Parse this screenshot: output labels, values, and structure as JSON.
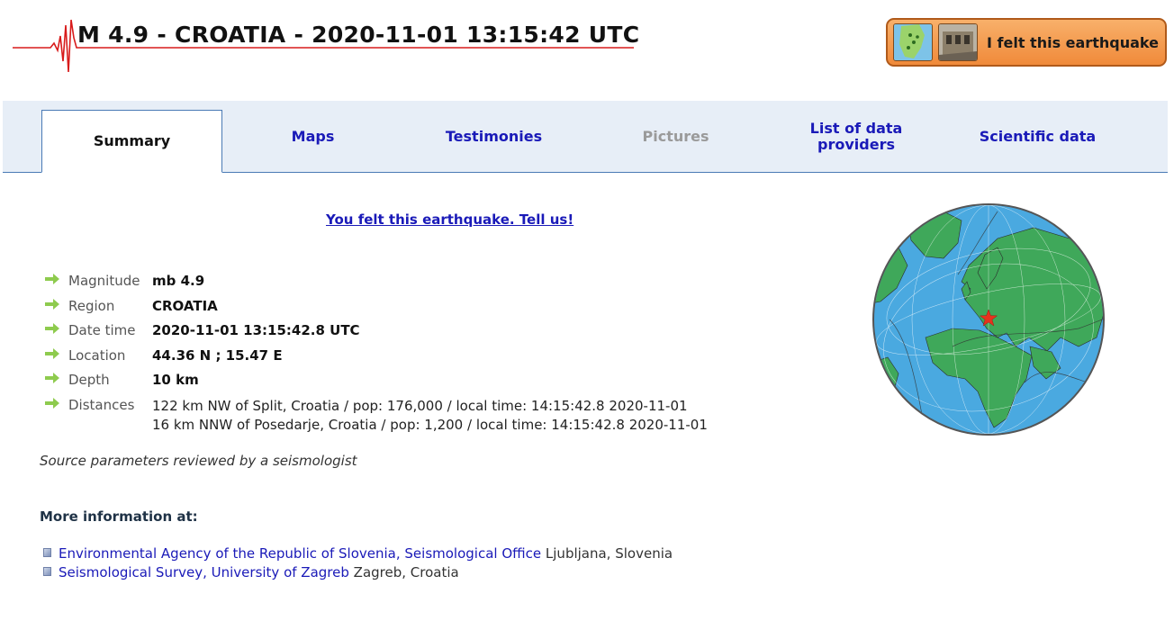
{
  "header": {
    "title": "M 4.9 - CROATIA - 2020-11-01 13:15:42 UTC",
    "felt_button_label": "I felt this earthquake"
  },
  "tabs": [
    {
      "label": "Summary",
      "active": true
    },
    {
      "label": "Maps"
    },
    {
      "label": "Testimonies"
    },
    {
      "label": "Pictures",
      "disabled": true
    },
    {
      "label": "List of data providers"
    },
    {
      "label": "Scientific data"
    }
  ],
  "summary": {
    "tell_us": "You felt this earthquake. Tell us!",
    "params": [
      {
        "label": "Magnitude",
        "value": "mb 4.9"
      },
      {
        "label": "Region",
        "value": "CROATIA"
      },
      {
        "label": "Date time",
        "value": "2020-11-01 13:15:42.8 UTC"
      },
      {
        "label": "Location",
        "value": "44.36 N ; 15.47 E"
      },
      {
        "label": "Depth",
        "value": "10 km"
      }
    ],
    "distances_label": "Distances",
    "distances": [
      "122 km NW of Split, Croatia / pop: 176,000 / local time: 14:15:42.8 2020-11-01",
      "16 km NNW of Posedarje, Croatia / pop: 1,200 / local time: 14:15:42.8 2020-11-01"
    ],
    "reviewed": "Source parameters reviewed by a seismologist",
    "more_info_heading": "More information at:",
    "links": [
      {
        "agency": "Environmental Agency of the Republic of Slovenia, Seismological Office",
        "city": "Ljubljana, Slovenia"
      },
      {
        "agency": "Seismological Survey, University of Zagreb",
        "city": "Zagreb, Croatia"
      }
    ]
  },
  "colors": {
    "link": "#1a1ab8",
    "tab_bar": "#e7eef7",
    "ocean": "#4aa9e0",
    "land": "#3fa85a",
    "epicenter": "#e8321e",
    "felt_button": "#f08a3a"
  },
  "icons": {
    "seismogram": "seismogram-logo-icon",
    "arrow": "green-arrow-icon",
    "bullet": "page-bullet-icon",
    "epicenter": "red-star-icon"
  }
}
